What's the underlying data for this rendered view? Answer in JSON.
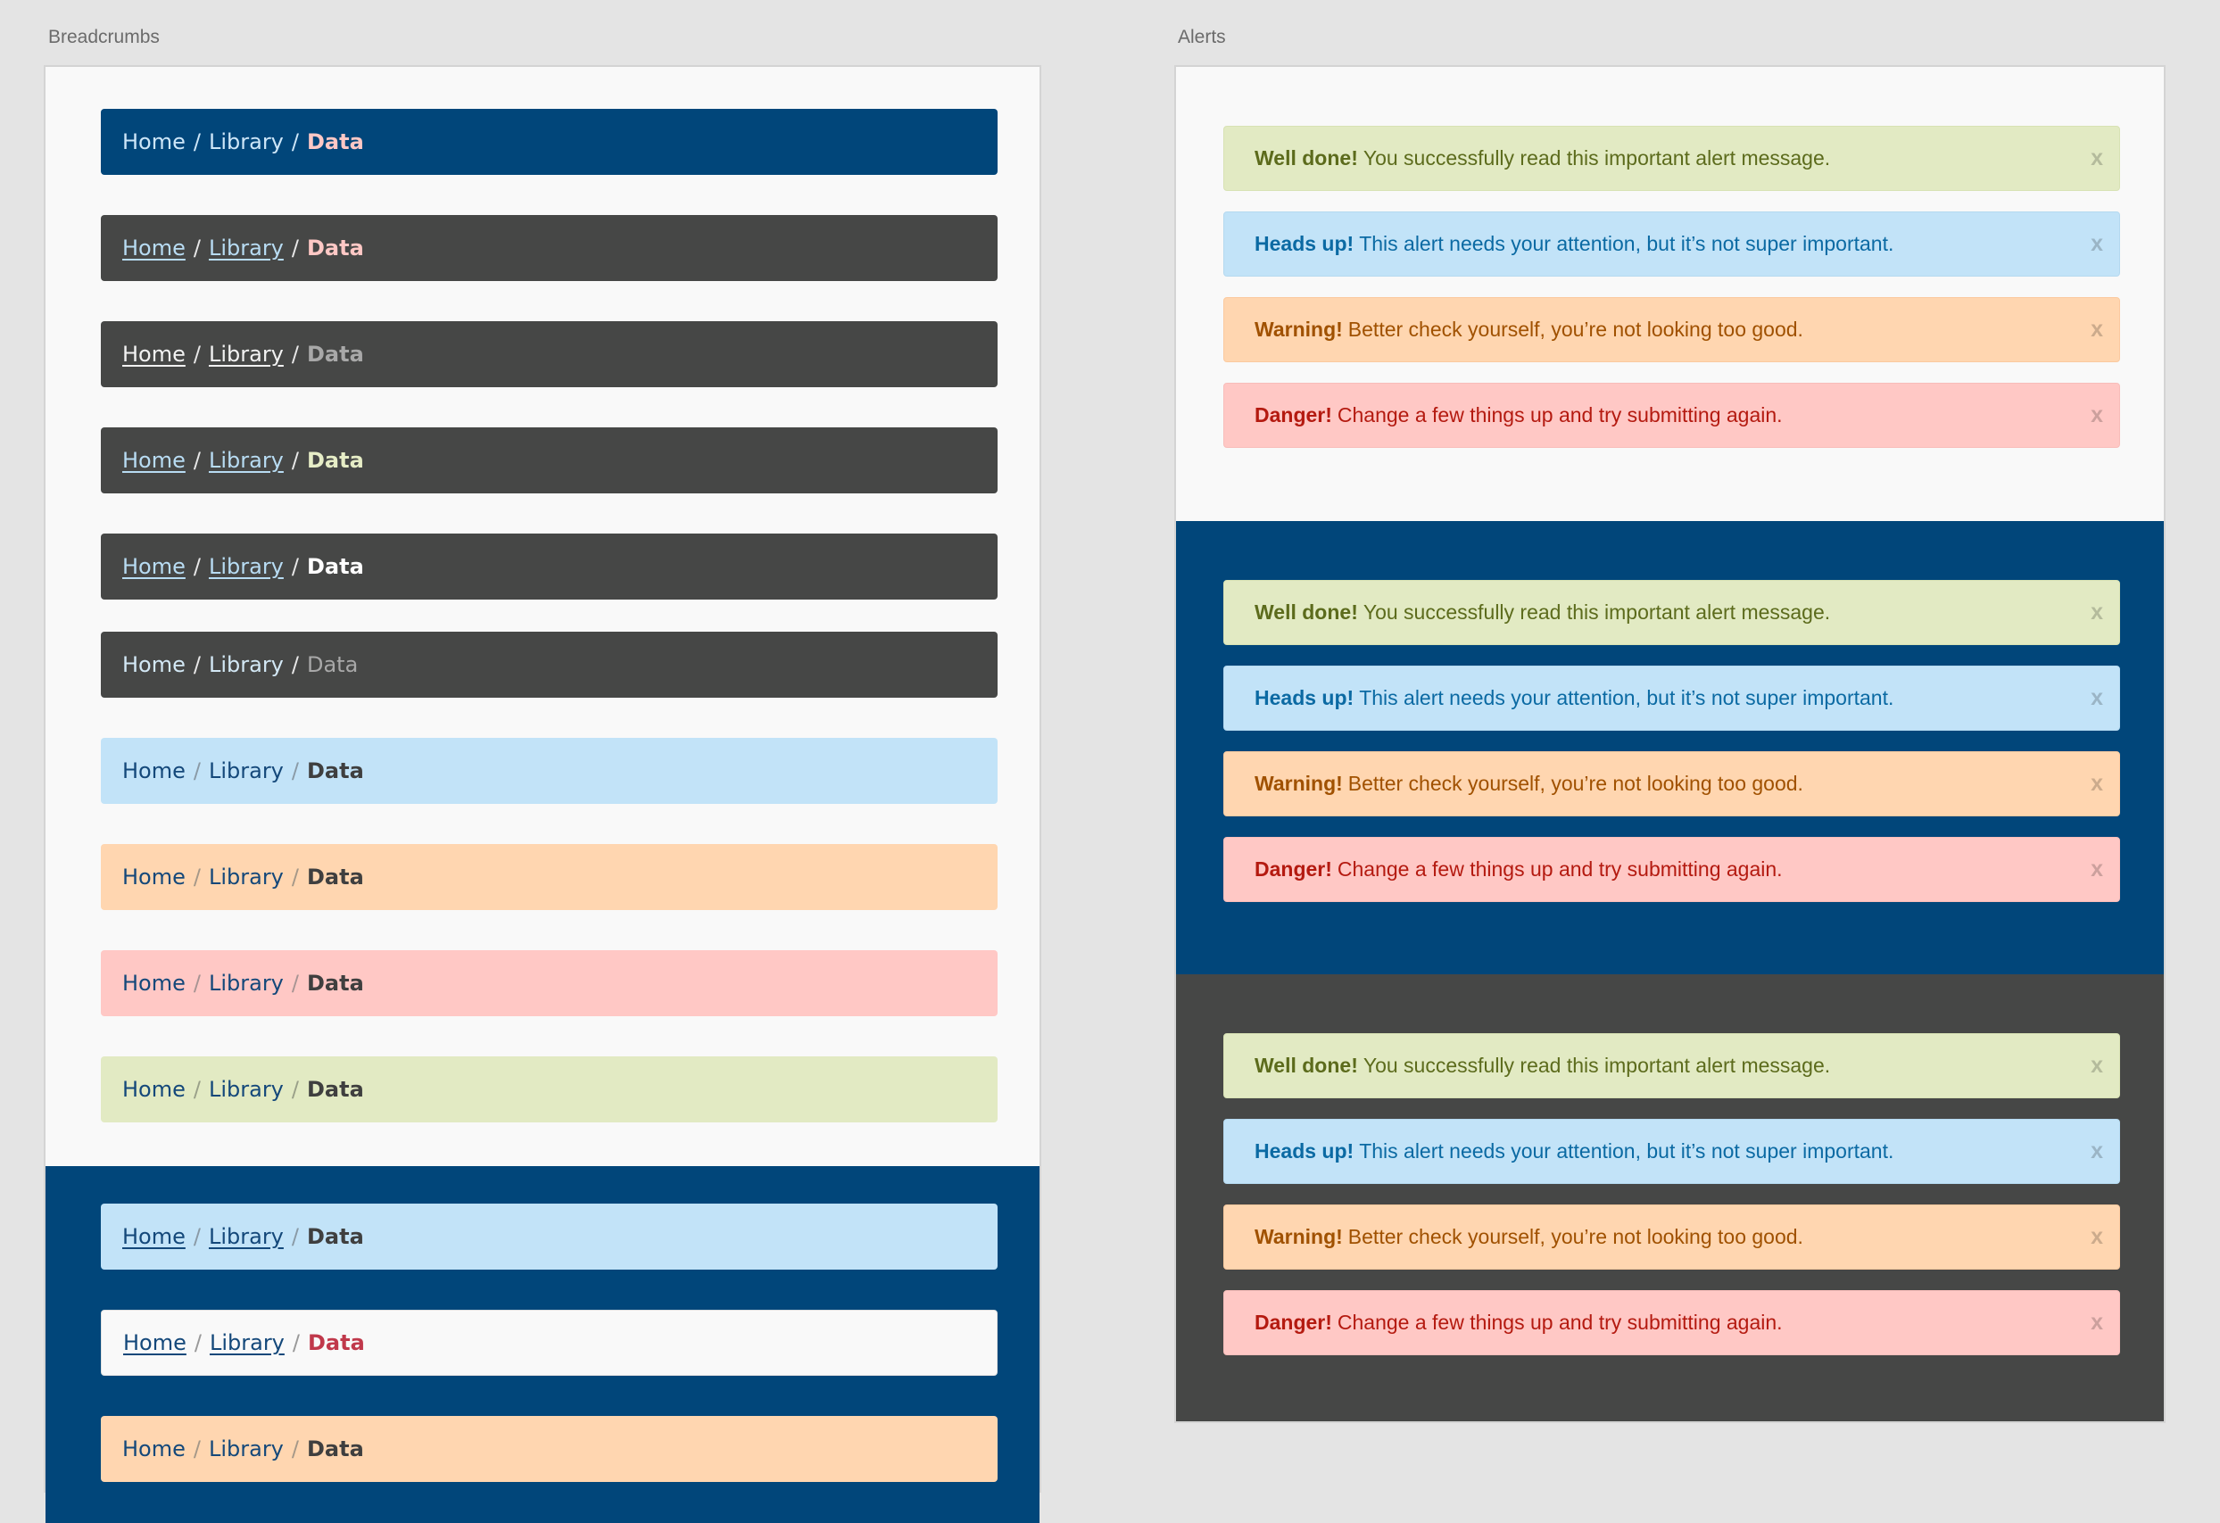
{
  "labels": {
    "breadcrumbs": "Breadcrumbs",
    "alerts": "Alerts"
  },
  "crumbs": {
    "home": "Home",
    "library": "Library",
    "data": "Data",
    "sep": "/"
  },
  "colors": {
    "navy": "#01467a",
    "dark": "#464746",
    "info_bg": "#c2e3f8",
    "warning_bg": "#ffd6b0",
    "danger_bg": "#ffc8c5",
    "success_bg": "#e2eac3",
    "light_bg": "#f9f9f9",
    "link_dark": "#14487a",
    "current_text": "#3f3f3f"
  },
  "breadcrumb_variants": [
    {
      "bg": "navy",
      "link_color": "#cde6f8",
      "underline": false,
      "sep_color": "#cde6f8",
      "current_color": "#ffc8c5",
      "current_weight": "bold"
    },
    {
      "bg": "dark",
      "link_color": "#b8dcf3",
      "underline": true,
      "sep_color": "#e8e8e8",
      "current_color": "#ffc8c5",
      "current_weight": "bold"
    },
    {
      "bg": "dark",
      "link_color": "#f2f2f2",
      "underline": true,
      "sep_color": "#e8e8e8",
      "current_color": "#a8a8a8",
      "current_weight": "bold"
    },
    {
      "bg": "dark",
      "link_color": "#b8dcf3",
      "underline": true,
      "sep_color": "#e8e8e8",
      "current_color": "#e6edc6",
      "current_weight": "bold"
    },
    {
      "bg": "dark",
      "link_color": "#b8dcf3",
      "underline": true,
      "sep_color": "#e8e8e8",
      "current_color": "#ffffff",
      "current_weight": "bold"
    },
    {
      "bg": "dark",
      "link_color": "#d3e8f5",
      "underline": false,
      "sep_color": "#e8e8e8",
      "current_color": "#a8a8a8",
      "current_weight": "normal"
    },
    {
      "bg": "info",
      "link_color": "#14487a",
      "underline": false,
      "sep_color": "#8a9aa6",
      "current_color": "#3f3f3f",
      "current_weight": "bold"
    },
    {
      "bg": "warning",
      "link_color": "#14487a",
      "underline": false,
      "sep_color": "#a59888",
      "current_color": "#3f3f3f",
      "current_weight": "bold"
    },
    {
      "bg": "danger",
      "link_color": "#14487a",
      "underline": false,
      "sep_color": "#a89493",
      "current_color": "#3f3f3f",
      "current_weight": "bold"
    },
    {
      "bg": "success",
      "link_color": "#14487a",
      "underline": false,
      "sep_color": "#9aa089",
      "current_color": "#3f3f3f",
      "current_weight": "bold"
    },
    {
      "bg": "info",
      "link_color": "#14487a",
      "underline": true,
      "sep_color": "#8a9aa6",
      "current_color": "#3f3f3f",
      "current_weight": "bold"
    },
    {
      "bg": "light",
      "link_color": "#14487a",
      "underline": true,
      "sep_color": "#999999",
      "current_color": "#c0394b",
      "current_weight": "bold"
    },
    {
      "bg": "warning",
      "link_color": "#14487a",
      "underline": false,
      "sep_color": "#a59888",
      "current_color": "#3f3f3f",
      "current_weight": "bold"
    }
  ],
  "alerts": [
    {
      "type": "success",
      "title": "Well done!",
      "message": "You successfully read this important alert message.",
      "close": "x"
    },
    {
      "type": "info",
      "title": "Heads up!",
      "message": "This alert needs your attention, but it’s not super important.",
      "close": "x"
    },
    {
      "type": "warning",
      "title": "Warning!",
      "message": "Better check yourself, you’re not looking too good.",
      "close": "x"
    },
    {
      "type": "danger",
      "title": "Danger!",
      "message": "Change a few things up and try submitting again.",
      "close": "x"
    }
  ]
}
